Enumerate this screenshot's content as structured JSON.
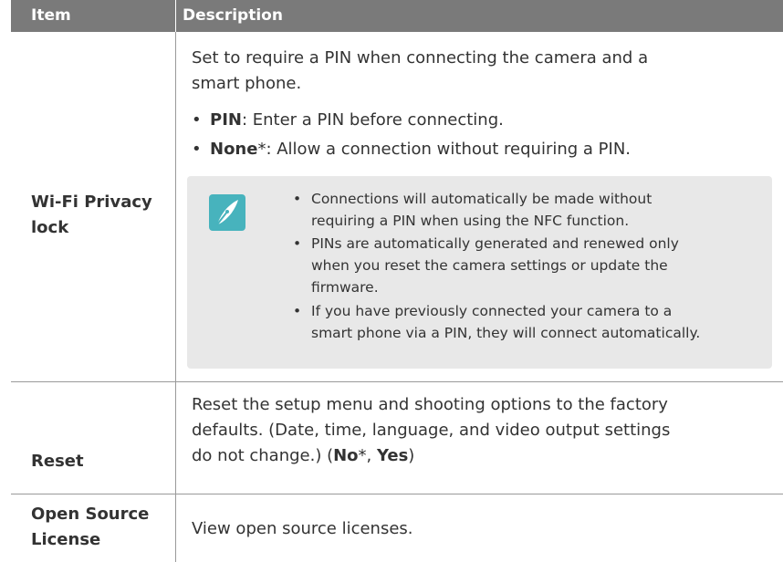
{
  "table": {
    "header": {
      "item": "Item",
      "description": "Description"
    },
    "rows": {
      "wifi": {
        "label_line1": "Wi-Fi Privacy",
        "label_line2": "lock",
        "intro_line1": "Set to require a PIN when connecting the camera and a",
        "intro_line2": "smart phone.",
        "bullets": [
          {
            "term": "PIN",
            "rest": ": Enter a PIN before connecting."
          },
          {
            "term": "None",
            "rest": "*: Allow a connection without requiring a PIN."
          }
        ],
        "note": {
          "icon": "pen-nib-icon",
          "lines": [
            [
              "Connections will automatically be made without",
              "requiring a PIN when using the NFC function."
            ],
            [
              "PINs are automatically generated and renewed only",
              "when you reset the camera settings or update the",
              "firmware."
            ],
            [
              "If you have previously connected your camera to a",
              "smart phone via a PIN, they will connect automatically."
            ]
          ]
        }
      },
      "reset": {
        "label": "Reset",
        "line1": "Reset the setup menu and shooting options to the factory",
        "line2": "defaults. (Date, time, language, and video output settings",
        "line3_pre": "do not change.) (",
        "line3_no": "No",
        "line3_mid": "*, ",
        "line3_yes": "Yes",
        "line3_post": ")"
      },
      "oss": {
        "label_line1": "Open Source",
        "label_line2": "License",
        "desc": "View open source licenses."
      }
    }
  },
  "colors": {
    "header_bg": "#7a7a7a",
    "note_bg": "#e8e8e8",
    "icon_bg": "#47b3bd"
  }
}
